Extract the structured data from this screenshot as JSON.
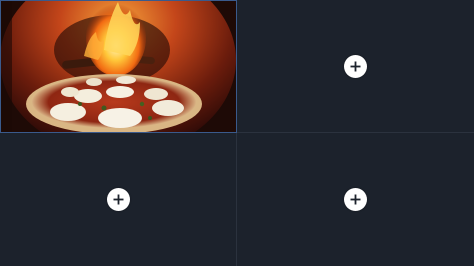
{
  "slots": [
    {
      "id": "slot-1",
      "state": "filled",
      "image": "pizza-in-wood-fired-oven"
    },
    {
      "id": "slot-2",
      "state": "empty",
      "action_icon": "plus-icon"
    },
    {
      "id": "slot-3",
      "state": "empty",
      "action_icon": "plus-icon"
    },
    {
      "id": "slot-4",
      "state": "empty",
      "action_icon": "plus-icon"
    }
  ],
  "colors": {
    "cell_background": "#1c222c",
    "divider": "#2b323e",
    "button_background": "#ffffff",
    "button_icon": "#1c222c",
    "selected_outline": "#3a5a8c"
  }
}
